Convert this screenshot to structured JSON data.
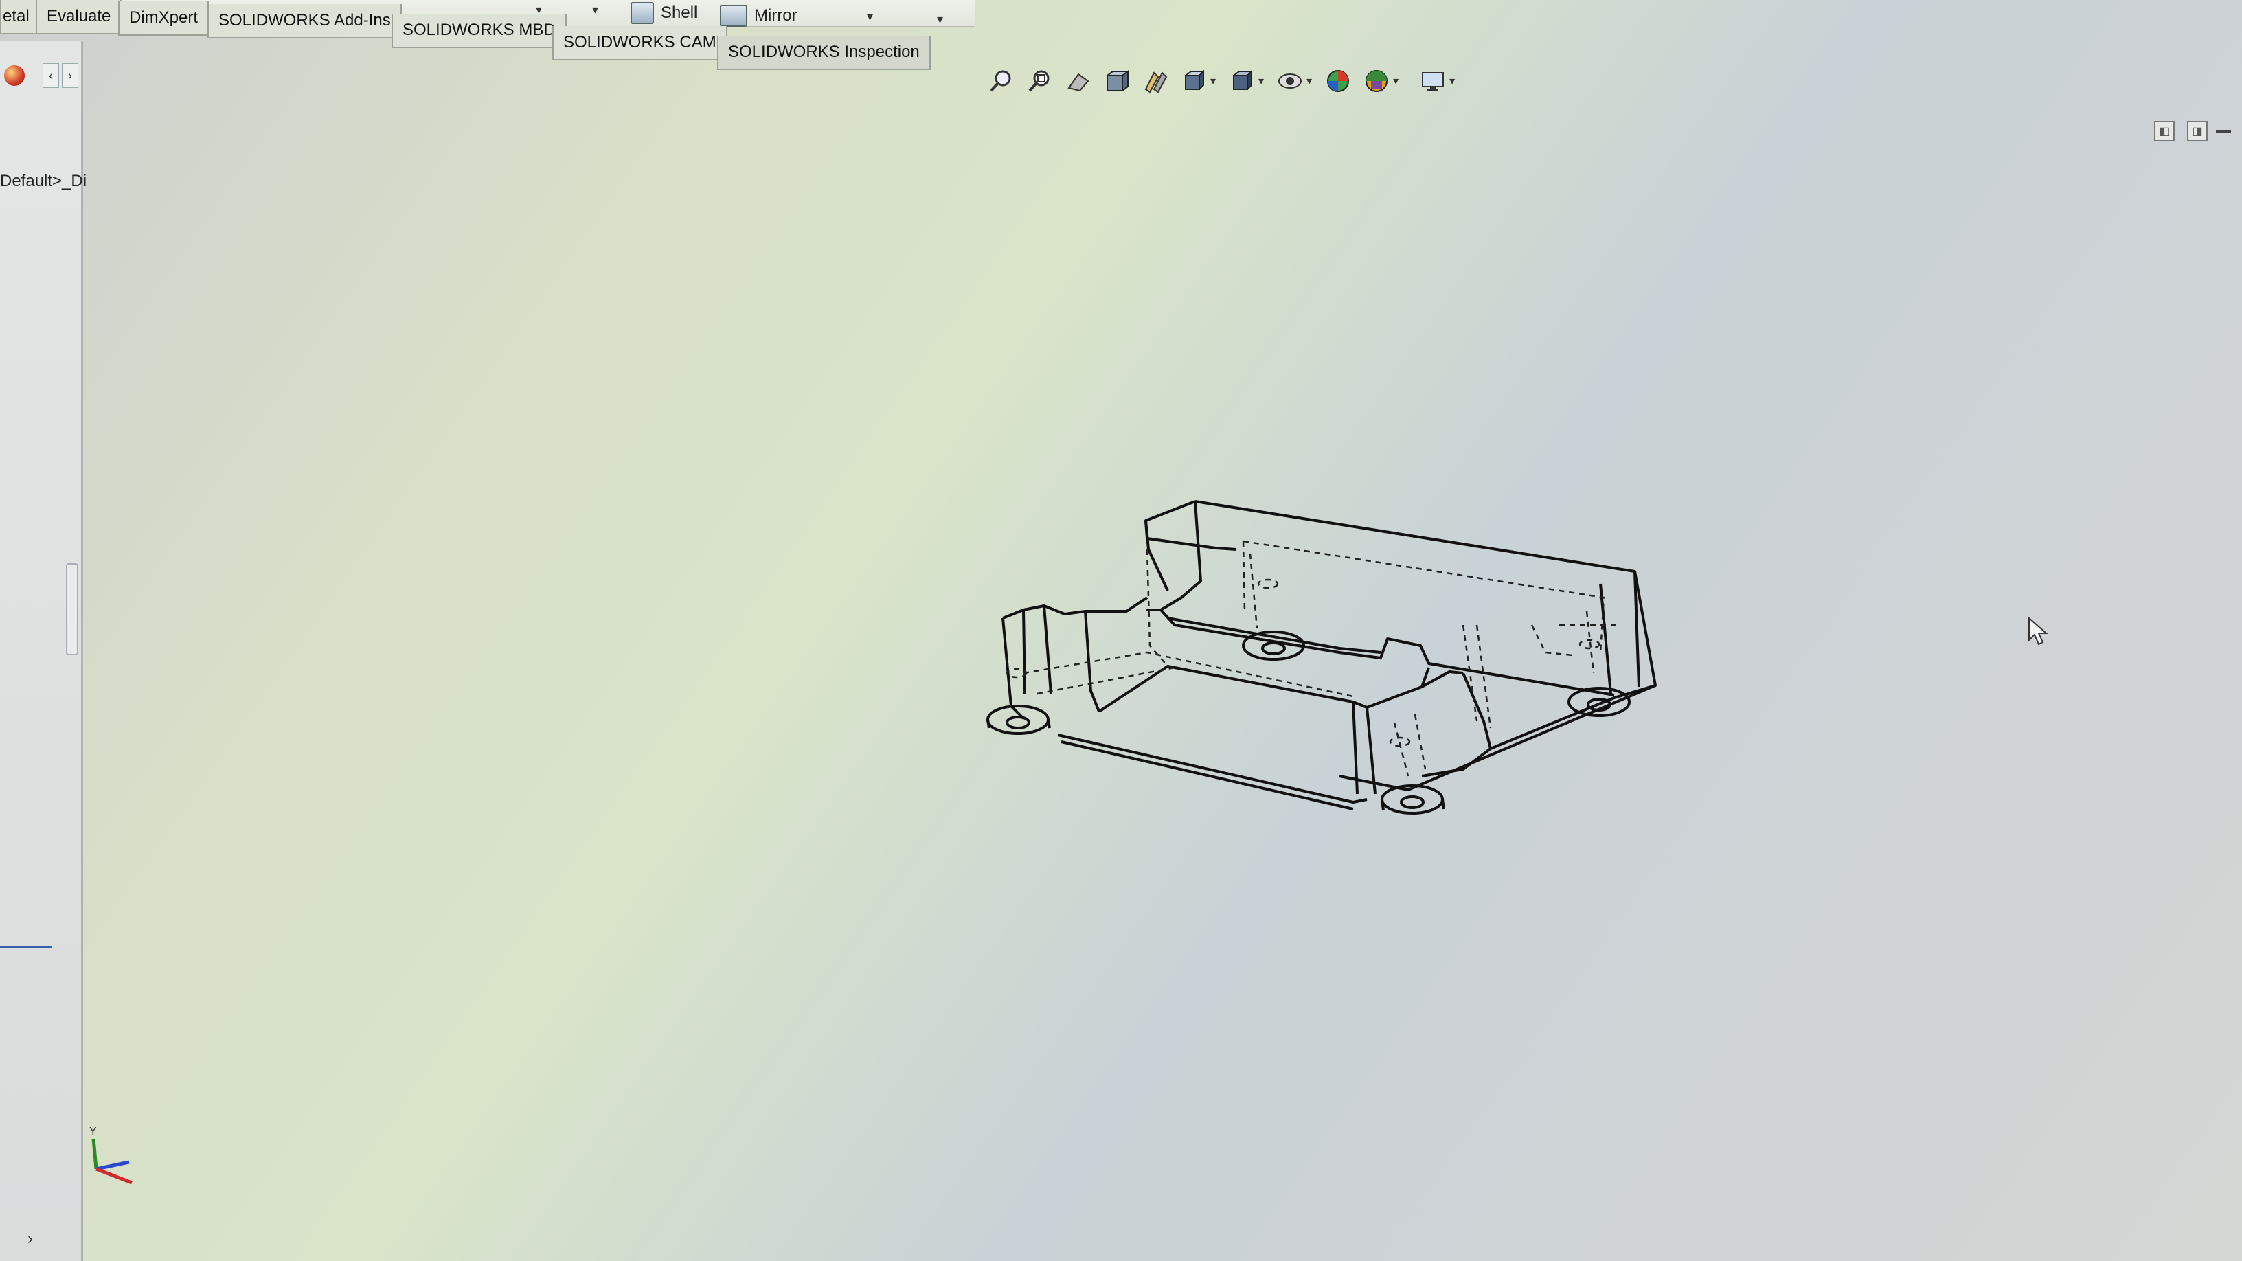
{
  "command_manager": {
    "shell_label": "Shell",
    "mirror_label": "Mirror"
  },
  "tabs": [
    {
      "label": "etal"
    },
    {
      "label": "Evaluate"
    },
    {
      "label": "DimXpert"
    },
    {
      "label": "SOLIDWORKS Add-Ins"
    },
    {
      "label": "SOLIDWORKS MBD"
    },
    {
      "label": "SOLIDWORKS CAM"
    },
    {
      "label": "SOLIDWORKS Inspection"
    }
  ],
  "feature_manager": {
    "configuration_label": "Default>_Di"
  },
  "heads_up_toolbar": {
    "icons": [
      "zoom-to-fit-icon",
      "zoom-to-area-icon",
      "previous-view-icon",
      "section-view-icon",
      "dynamic-annotation-icon",
      "view-orientation-icon",
      "display-style-icon",
      "hide-show-items-icon",
      "edit-appearance-icon",
      "apply-scene-icon",
      "view-settings-icon"
    ]
  },
  "triad": {
    "y_label": "Y"
  },
  "colors": {
    "tab_bg": "#dde2d6",
    "model_line": "#111111",
    "selection_blue": "#3a5fa8"
  }
}
